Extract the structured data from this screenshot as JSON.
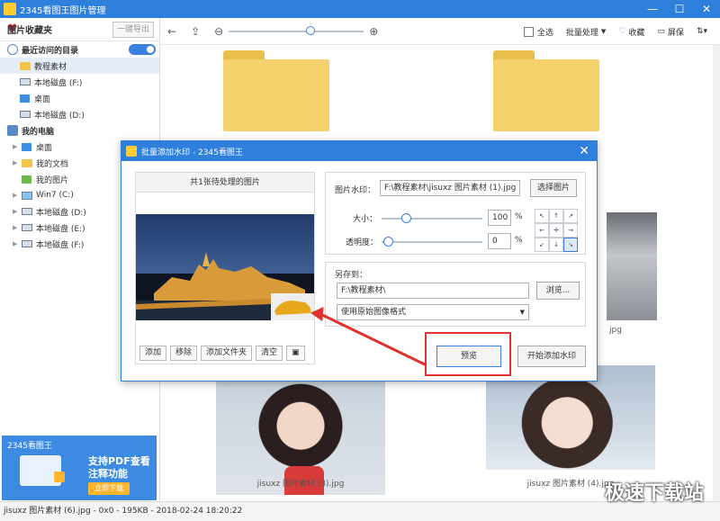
{
  "window": {
    "title": "2345看图王图片管理",
    "minimize": "—",
    "maximize": "☐",
    "close": "✕"
  },
  "sidebar": {
    "favorites_label": "图片收藏夹",
    "export_button": "一键导出",
    "recent_label": "最近访问的目录",
    "recent_items": [
      "教程素材",
      "本地磁盘 (F:)",
      "桌面",
      "本地磁盘 (D:)"
    ],
    "mypc_label": "我的电脑",
    "pc_items": [
      "桌面",
      "我的文档",
      "我的图片",
      "Win7 (C:)",
      "本地磁盘 (D:)",
      "本地磁盘 (E:)",
      "本地磁盘 (F:)"
    ]
  },
  "ad": {
    "brand": "2345看图王",
    "line1": "支持PDF查看",
    "line2": "注释功能",
    "button": "立即下载"
  },
  "toolbar": {
    "select_all": "全选",
    "batch": "批量处理",
    "favorite": "收藏",
    "screen": "屏保",
    "zoom_level": 0.6
  },
  "content": {
    "captions": [
      "jisuxz 图片素材 (3).jpg",
      "jisuxz 图片素材 (4).jpg"
    ],
    "partial_caption_left": "jpg",
    "partial_caption_right": "jpg"
  },
  "status": {
    "text": "jisuxz 图片素材 (6).jpg - 0x0 - 195KB - 2018-02-24 18:20:22"
  },
  "watermark": "极速下载站",
  "dialog": {
    "title": "批量添加水印 - 2345看图王",
    "close": "✕",
    "pending_label": "共1张待处理的图片",
    "buttons": {
      "add": "添加",
      "remove": "移除",
      "add_folder": "添加文件夹",
      "clear": "清空"
    },
    "wm_label": "图片水印：",
    "wm_path": "F:\\教程素材\\jisuxz 图片素材 (1).jpg",
    "choose_image": "选择图片",
    "size_label": "大小：",
    "size_value": "100",
    "opacity_label": "透明度：",
    "opacity_value": "0",
    "percent": "%",
    "saveto_label": "另存到：",
    "save_path": "F:\\教程素材\\",
    "browse": "浏览...",
    "format": "使用原始图像格式",
    "preview": "预览",
    "start": "开始添加水印"
  }
}
